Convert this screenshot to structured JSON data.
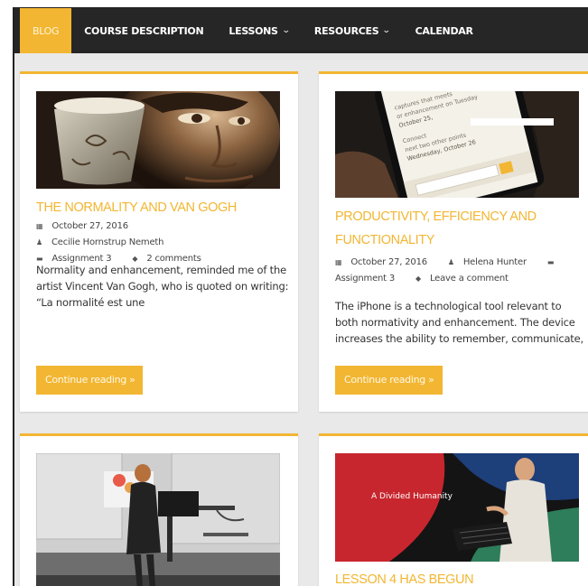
{
  "nav": {
    "items": [
      {
        "label": "BLOG",
        "active": true,
        "dropdown": false
      },
      {
        "label": "COURSE DESCRIPTION",
        "active": false,
        "dropdown": false
      },
      {
        "label": "LESSONS",
        "active": false,
        "dropdown": true
      },
      {
        "label": "RESOURCES",
        "active": false,
        "dropdown": true
      },
      {
        "label": "CALENDAR",
        "active": false,
        "dropdown": false
      }
    ],
    "chevron_icon": "chevron-down-icon"
  },
  "colors": {
    "accent": "#f2b632",
    "nav_bg": "#262626",
    "page_bg": "#e9e9e9"
  },
  "posts": [
    {
      "title": "THE NORMALITY AND VAN GOGH",
      "date": "October 27, 2016",
      "author": "Cecilie Hornstrup Nemeth",
      "category": "Assignment 3",
      "comments": "2 comments",
      "excerpt": "Normality and enhancement, reminded me of the artist Vincent Van Gogh, who is quoted on writing: “La normalité est une",
      "button": "Continue reading »",
      "image": "van-gogh-painting"
    },
    {
      "title": "PRODUCTIVITY, EFFICIENCY AND FUNCTIONALITY",
      "date": "October 27, 2016",
      "author": "Helena Hunter",
      "category": "Assignment 3",
      "comments": "Leave a comment",
      "excerpt": "The iPhone is a technological tool relevant to both normativity and enhancement. The device increases the ability to remember, communicate,",
      "button": "Continue reading »",
      "image": "phone-calendar-photo",
      "phone_lines": [
        "captures that meets",
        "or enhancement on Tuesday",
        "October 25,",
        "Connect",
        "next two other points",
        "Wednesday, October 26"
      ]
    },
    {
      "image": "lecture-classroom-photo"
    },
    {
      "title": "LESSON 4 HAS BEGUN",
      "image": "divided-humanity-speaker-photo",
      "image_caption": "A Divided Humanity"
    }
  ],
  "icons": {
    "date": "calendar-icon",
    "author": "user-icon",
    "category": "folder-icon",
    "comments": "comment-icon"
  }
}
